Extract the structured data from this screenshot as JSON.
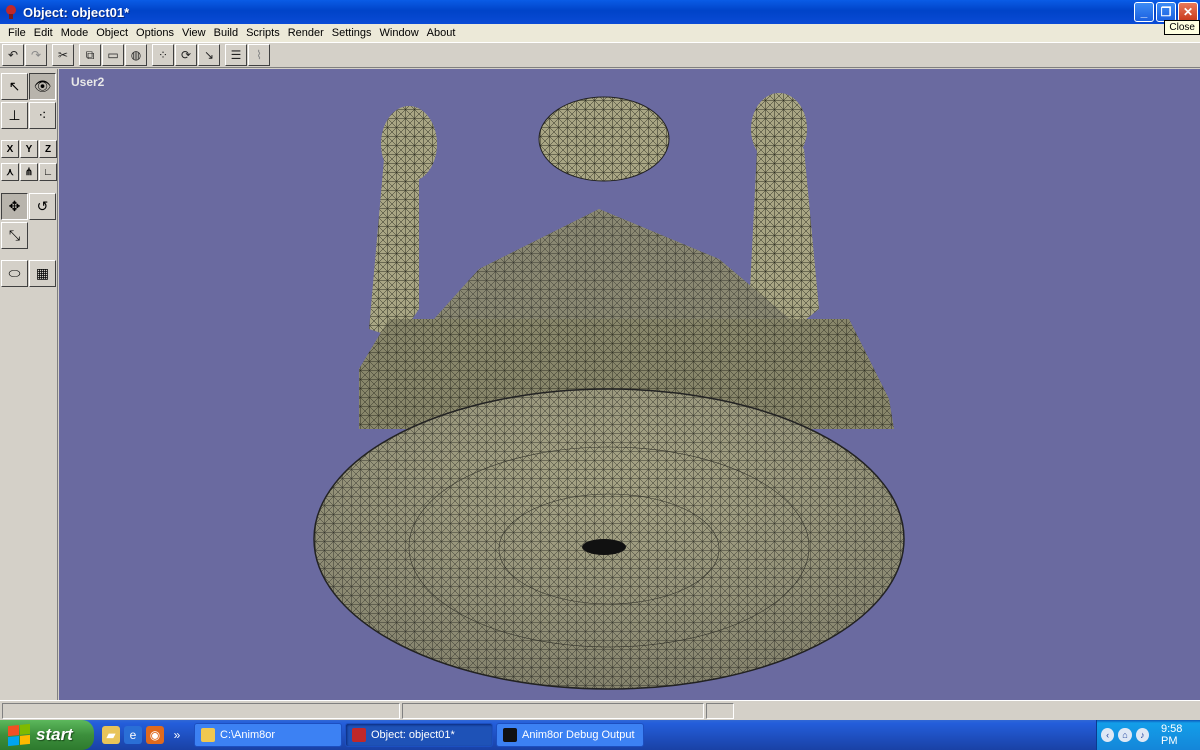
{
  "window": {
    "title": "Object: object01*",
    "tooltip": "Close"
  },
  "menu": [
    "File",
    "Edit",
    "Mode",
    "Object",
    "Options",
    "View",
    "Build",
    "Scripts",
    "Render",
    "Settings",
    "Window",
    "About"
  ],
  "toolbar": {
    "icons": [
      "undo-icon",
      "redo-icon",
      "cut-icon",
      "copy-icon",
      "paste-icon",
      "sphere-icon",
      "points-icon",
      "rotate-view-icon",
      "snap-icon",
      "list-icon",
      "graph-icon"
    ]
  },
  "tools": {
    "axes": [
      "X",
      "Y",
      "Z"
    ]
  },
  "viewport": {
    "label": "User2",
    "background": "#6a6aa0",
    "mesh_color": "#a9a684"
  },
  "taskbar": {
    "start_label": "start",
    "tasks": [
      {
        "label": "C:\\Anim8or",
        "icon": "folder-icon"
      },
      {
        "label": "Object: object01*",
        "icon": "anim8or-icon"
      },
      {
        "label": "Anim8or Debug Output",
        "icon": "console-icon"
      }
    ],
    "clock": "9:58 PM"
  }
}
